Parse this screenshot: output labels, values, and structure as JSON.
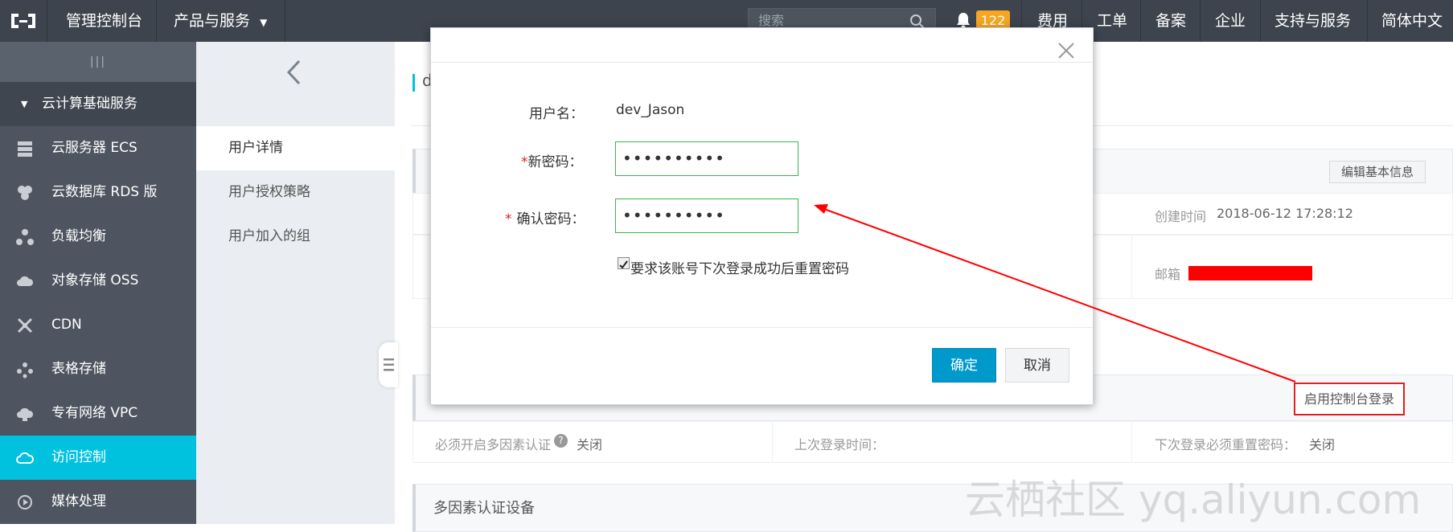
{
  "topbar": {
    "console_title": "管理控制台",
    "products_menu": "产品与服务",
    "search_placeholder": "搜索",
    "notification_count": "122",
    "links": [
      "费用",
      "工单",
      "备案",
      "企业",
      "支持与服务",
      "简体中文"
    ]
  },
  "sidebar": {
    "collapse_glyph": "|||",
    "section_title": "云计算基础服务",
    "items": [
      {
        "label": "云服务器 ECS",
        "icon": "server-icon"
      },
      {
        "label": "云数据库 RDS 版",
        "icon": "database-icon"
      },
      {
        "label": "负载均衡",
        "icon": "load-balancer-icon"
      },
      {
        "label": "对象存储 OSS",
        "icon": "cloud-storage-icon"
      },
      {
        "label": "CDN",
        "icon": "cdn-icon"
      },
      {
        "label": "表格存储",
        "icon": "table-storage-icon"
      },
      {
        "label": "专有网络 VPC",
        "icon": "vpc-icon"
      },
      {
        "label": "访问控制",
        "icon": "access-control-icon",
        "active": true
      },
      {
        "label": "媒体处理",
        "icon": "media-icon"
      }
    ]
  },
  "subnav": {
    "back_glyph": "‹",
    "items": [
      "用户详情",
      "用户授权策略",
      "用户加入的组"
    ]
  },
  "main": {
    "title_fragment": "d",
    "edit_basic_info": "编辑基本信息",
    "created_label": "创建时间",
    "created_value": "2018-06-12 17:28:12",
    "email_label": "邮箱",
    "enable_console_login": "启用控制台登录",
    "mfa_required_label": "必须开启多因素认证",
    "mfa_required_value": "关闭",
    "last_login_label": "上次登录时间：",
    "reset_pwd_label": "下次登录必须重置密码：",
    "reset_pwd_value": "关闭",
    "mfa_device_title": "多因素认证设备"
  },
  "modal": {
    "username_label": "用户名：",
    "username_value": "dev_Jason",
    "new_pwd_label": "新密码：",
    "new_pwd_value": "••••••••••",
    "confirm_pwd_label": "确认密码：",
    "confirm_pwd_value": "••••••••••",
    "required_mark": "*",
    "reset_checkbox_label": "要求该账号下次登录成功后重置密码",
    "reset_checkbox_checked": true,
    "ok_label": "确定",
    "cancel_label": "取消",
    "close_glyph": "×"
  },
  "watermark": "云栖社区 yq.aliyun.com",
  "colors": {
    "topbar": "#3d444d",
    "sidebar": "#4e5560",
    "active": "#00c1de",
    "primary_button": "#0099cc",
    "badge": "#f5a623",
    "annotation_red": "#ff0000"
  }
}
